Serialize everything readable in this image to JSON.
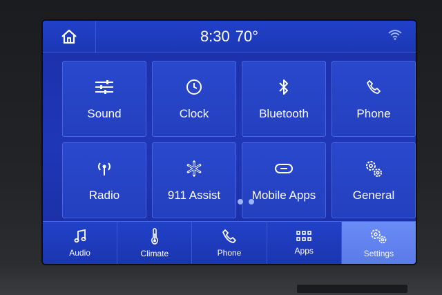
{
  "status_bar": {
    "time": "8:30",
    "temperature": "70°"
  },
  "icons": {
    "home": "home-icon",
    "wifi": "wifi-icon"
  },
  "tiles": [
    {
      "label": "Sound",
      "icon": "equalizer-icon"
    },
    {
      "label": "Clock",
      "icon": "clock-icon"
    },
    {
      "label": "Bluetooth",
      "icon": "bluetooth-icon"
    },
    {
      "label": "Phone",
      "icon": "phone-icon"
    },
    {
      "label": "Radio",
      "icon": "radio-antenna-icon"
    },
    {
      "label": "911 Assist",
      "icon": "asterisk-icon"
    },
    {
      "label": "Mobile Apps",
      "icon": "mobile-apps-icon"
    },
    {
      "label": "General",
      "icon": "gears-icon"
    }
  ],
  "pagination": {
    "pages": 2
  },
  "bottom_nav": [
    {
      "label": "Audio",
      "icon": "music-note-icon"
    },
    {
      "label": "Climate",
      "icon": "thermometer-icon"
    },
    {
      "label": "Phone",
      "icon": "phone-icon"
    },
    {
      "label": "Apps",
      "icon": "apps-grid-icon"
    },
    {
      "label": "Settings",
      "icon": "gears-icon",
      "active": true
    }
  ],
  "colors": {
    "screen": "#1f36b8",
    "tile": "#2a48cc",
    "active_tab": "#6a8cf6",
    "text": "#ffffff"
  }
}
